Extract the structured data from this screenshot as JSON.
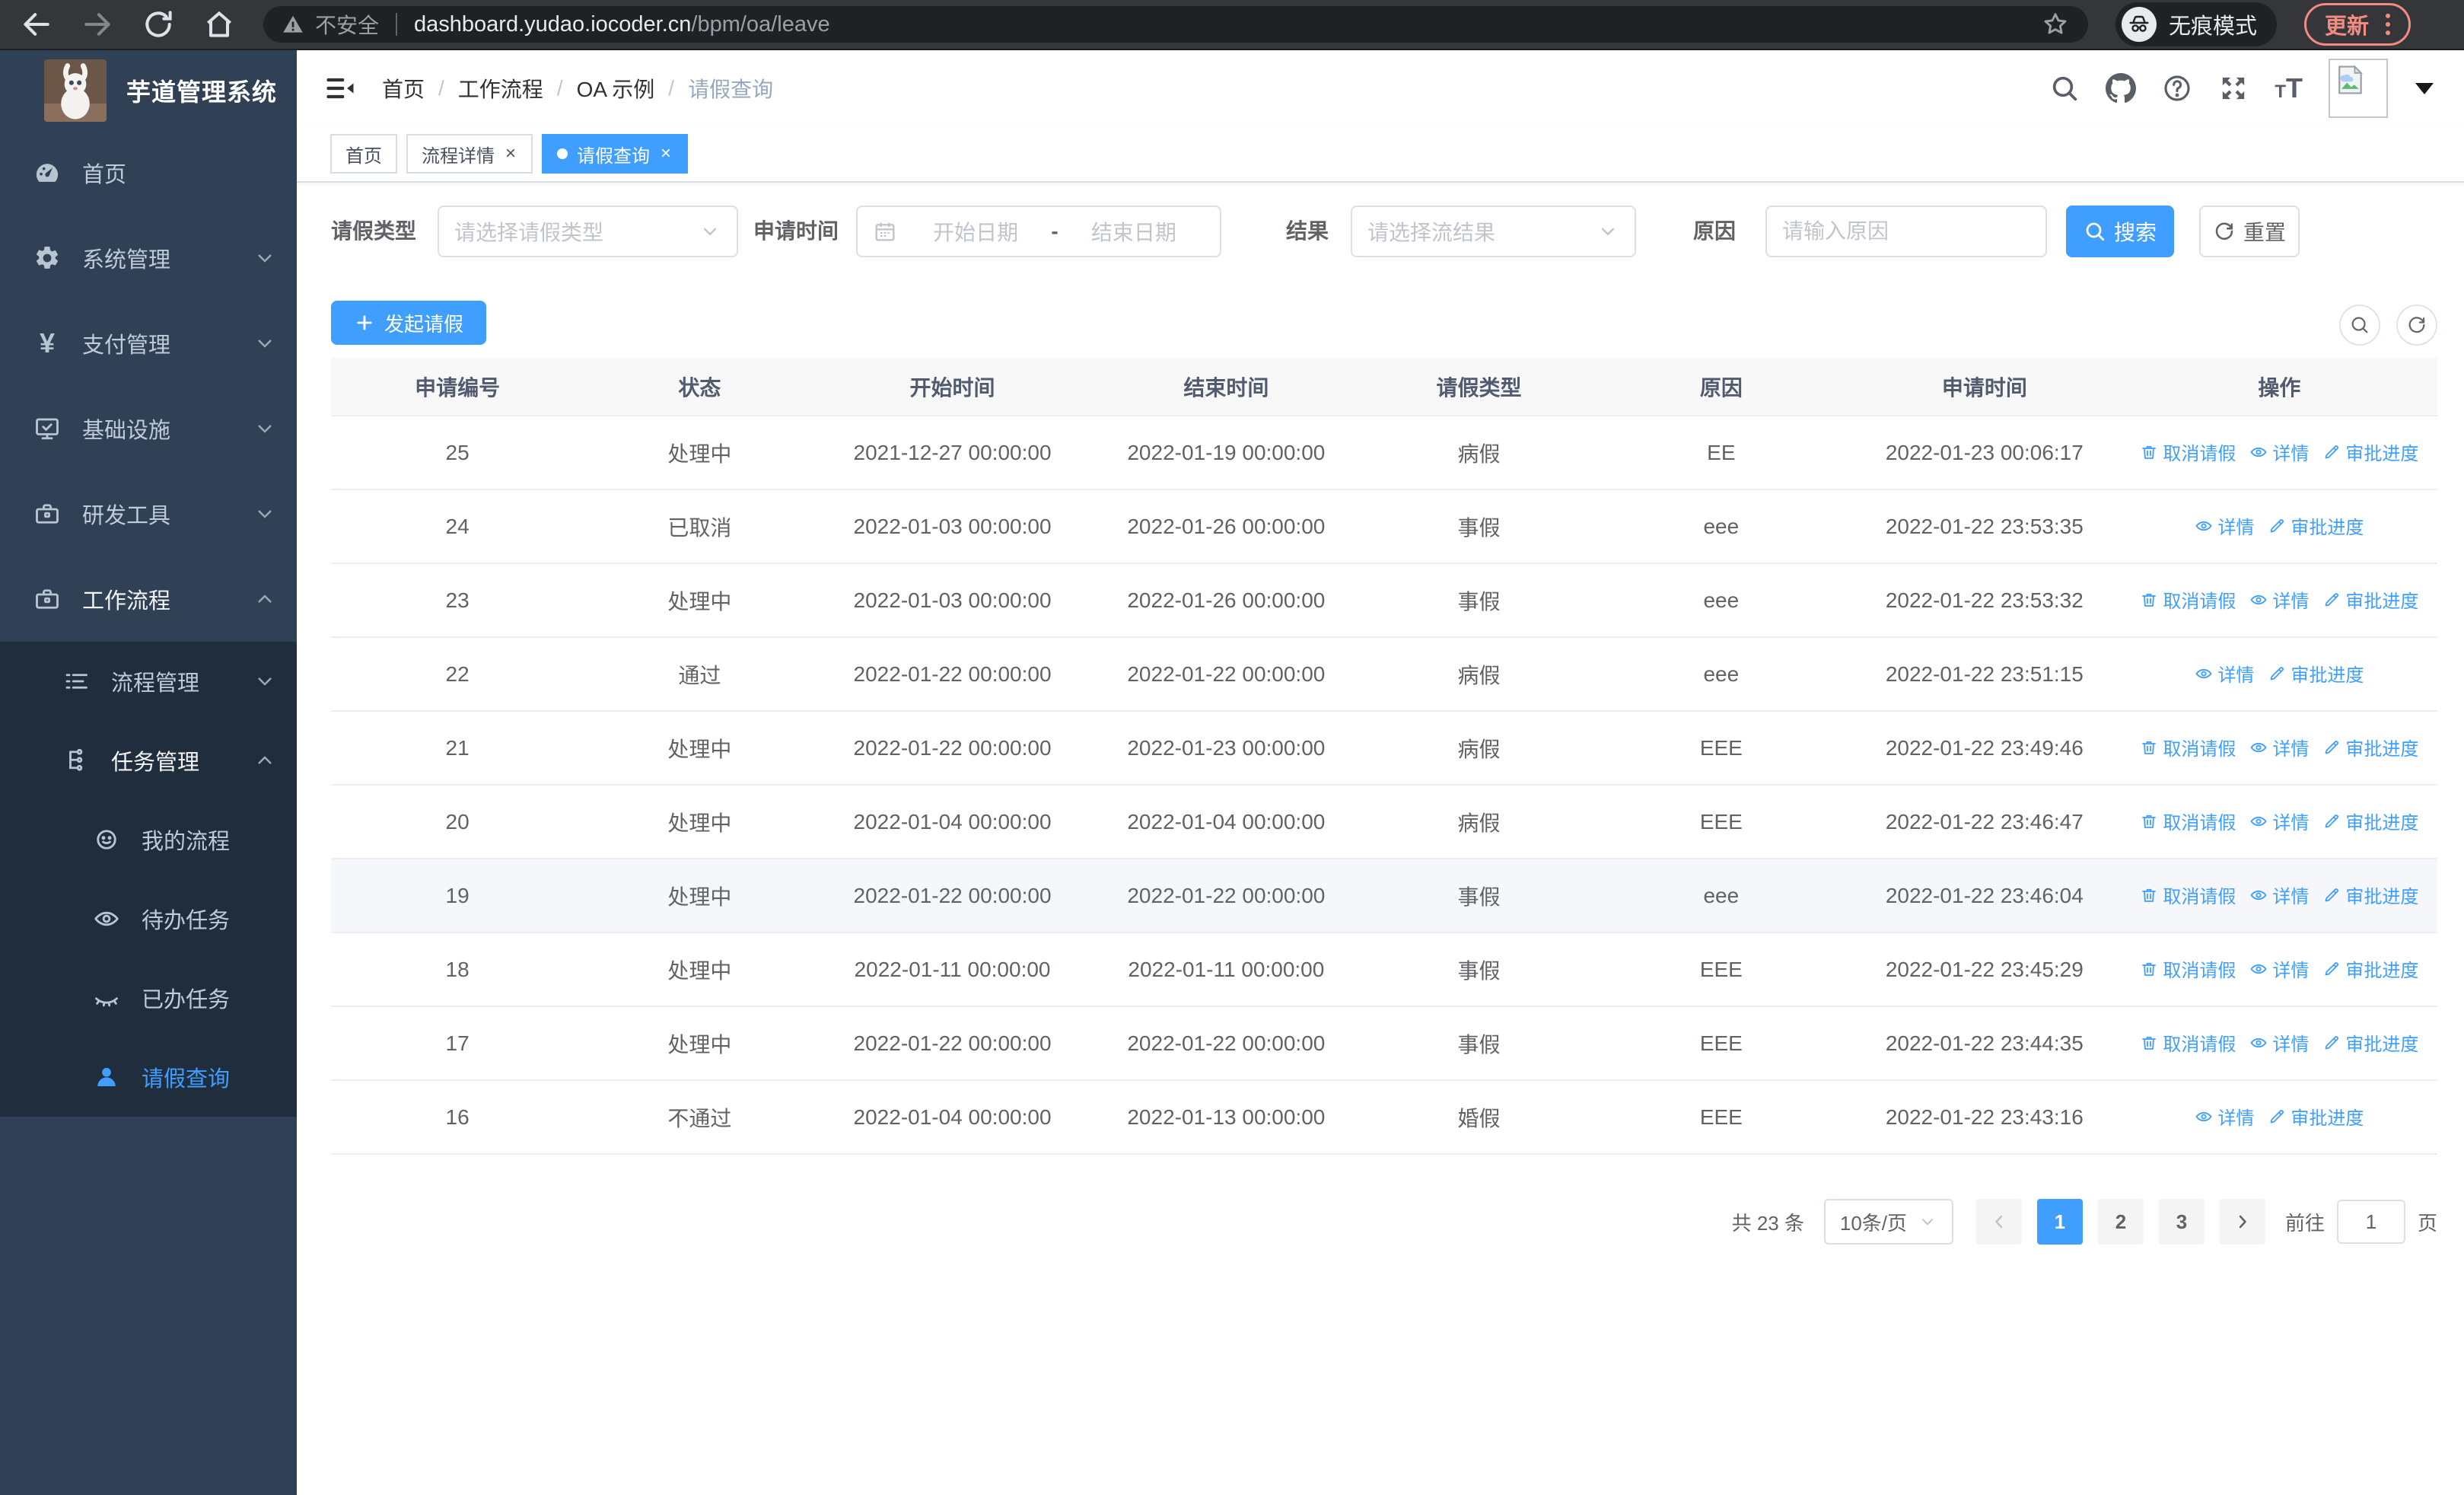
{
  "browser": {
    "security_label": "不安全",
    "url_host": "dashboard.yudao.iocoder.cn",
    "url_path": "/bpm/oa/leave",
    "incognito_label": "无痕模式",
    "update_label": "更新"
  },
  "sidebar": {
    "title": "芋道管理系统",
    "items": [
      {
        "key": "home",
        "label": "首页",
        "icon": "dashboard",
        "expandable": false,
        "expanded": false
      },
      {
        "key": "system",
        "label": "系统管理",
        "icon": "gear",
        "expandable": true,
        "expanded": false
      },
      {
        "key": "payment",
        "label": "支付管理",
        "icon": "yen",
        "expandable": true,
        "expanded": false
      },
      {
        "key": "infra",
        "label": "基础设施",
        "icon": "monitor",
        "expandable": true,
        "expanded": false
      },
      {
        "key": "devtools",
        "label": "研发工具",
        "icon": "toolbox",
        "expandable": true,
        "expanded": false
      },
      {
        "key": "workflow",
        "label": "工作流程",
        "icon": "toolbox",
        "expandable": true,
        "expanded": true
      }
    ],
    "submenu": [
      {
        "key": "process-mgmt",
        "label": "流程管理",
        "icon": "list",
        "expandable": true,
        "expanded": false
      },
      {
        "key": "task-mgmt",
        "label": "任务管理",
        "icon": "flow",
        "expandable": true,
        "expanded": true
      }
    ],
    "tasks": [
      {
        "key": "my-process",
        "label": "我的流程",
        "icon": "face",
        "active": false
      },
      {
        "key": "todo-tasks",
        "label": "待办任务",
        "icon": "eye",
        "active": false
      },
      {
        "key": "done-tasks",
        "label": "已办任务",
        "icon": "eye-closed",
        "active": false
      },
      {
        "key": "leave-query",
        "label": "请假查询",
        "icon": "user",
        "active": true
      }
    ]
  },
  "header": {
    "breadcrumb": [
      "首页",
      "工作流程",
      "OA 示例",
      "请假查询"
    ],
    "breadcrumb_separator": "/"
  },
  "tabs": [
    {
      "key": "home",
      "label": "首页",
      "closable": false,
      "active": false
    },
    {
      "key": "process-detail",
      "label": "流程详情",
      "closable": true,
      "active": false
    },
    {
      "key": "leave-query",
      "label": "请假查询",
      "closable": true,
      "active": true
    }
  ],
  "filters": {
    "leave_type": {
      "label": "请假类型",
      "placeholder": "请选择请假类型"
    },
    "apply_time": {
      "label": "申请时间",
      "start_placeholder": "开始日期",
      "separator": "-",
      "end_placeholder": "结束日期"
    },
    "result": {
      "label": "结果",
      "placeholder": "请选择流结果"
    },
    "reason": {
      "label": "原因",
      "placeholder": "请输入原因"
    },
    "search_label": "搜索",
    "reset_label": "重置"
  },
  "toolbar": {
    "create_label": "发起请假"
  },
  "table": {
    "columns": [
      {
        "key": "id",
        "label": "申请编号"
      },
      {
        "key": "status",
        "label": "状态"
      },
      {
        "key": "start",
        "label": "开始时间"
      },
      {
        "key": "end",
        "label": "结束时间"
      },
      {
        "key": "type",
        "label": "请假类型"
      },
      {
        "key": "reason",
        "label": "原因"
      },
      {
        "key": "applied",
        "label": "申请时间"
      },
      {
        "key": "actions",
        "label": "操作"
      }
    ],
    "action_labels": {
      "cancel": "取消请假",
      "detail": "详情",
      "progress": "审批进度"
    },
    "rows": [
      {
        "id": "25",
        "status": "处理中",
        "start": "2021-12-27 00:00:00",
        "end": "2022-01-19 00:00:00",
        "type": "病假",
        "reason": "EE",
        "applied": "2022-01-23 00:06:17",
        "actions": [
          "cancel",
          "detail",
          "progress"
        ],
        "highlight": false
      },
      {
        "id": "24",
        "status": "已取消",
        "start": "2022-01-03 00:00:00",
        "end": "2022-01-26 00:00:00",
        "type": "事假",
        "reason": "eee",
        "applied": "2022-01-22 23:53:35",
        "actions": [
          "detail",
          "progress"
        ],
        "highlight": false
      },
      {
        "id": "23",
        "status": "处理中",
        "start": "2022-01-03 00:00:00",
        "end": "2022-01-26 00:00:00",
        "type": "事假",
        "reason": "eee",
        "applied": "2022-01-22 23:53:32",
        "actions": [
          "cancel",
          "detail",
          "progress"
        ],
        "highlight": false
      },
      {
        "id": "22",
        "status": "通过",
        "start": "2022-01-22 00:00:00",
        "end": "2022-01-22 00:00:00",
        "type": "病假",
        "reason": "eee",
        "applied": "2022-01-22 23:51:15",
        "actions": [
          "detail",
          "progress"
        ],
        "highlight": false
      },
      {
        "id": "21",
        "status": "处理中",
        "start": "2022-01-22 00:00:00",
        "end": "2022-01-23 00:00:00",
        "type": "病假",
        "reason": "EEE",
        "applied": "2022-01-22 23:49:46",
        "actions": [
          "cancel",
          "detail",
          "progress"
        ],
        "highlight": false
      },
      {
        "id": "20",
        "status": "处理中",
        "start": "2022-01-04 00:00:00",
        "end": "2022-01-04 00:00:00",
        "type": "病假",
        "reason": "EEE",
        "applied": "2022-01-22 23:46:47",
        "actions": [
          "cancel",
          "detail",
          "progress"
        ],
        "highlight": false
      },
      {
        "id": "19",
        "status": "处理中",
        "start": "2022-01-22 00:00:00",
        "end": "2022-01-22 00:00:00",
        "type": "事假",
        "reason": "eee",
        "applied": "2022-01-22 23:46:04",
        "actions": [
          "cancel",
          "detail",
          "progress"
        ],
        "highlight": true
      },
      {
        "id": "18",
        "status": "处理中",
        "start": "2022-01-11 00:00:00",
        "end": "2022-01-11 00:00:00",
        "type": "事假",
        "reason": "EEE",
        "applied": "2022-01-22 23:45:29",
        "actions": [
          "cancel",
          "detail",
          "progress"
        ],
        "highlight": false
      },
      {
        "id": "17",
        "status": "处理中",
        "start": "2022-01-22 00:00:00",
        "end": "2022-01-22 00:00:00",
        "type": "事假",
        "reason": "EEE",
        "applied": "2022-01-22 23:44:35",
        "actions": [
          "cancel",
          "detail",
          "progress"
        ],
        "highlight": false
      },
      {
        "id": "16",
        "status": "不通过",
        "start": "2022-01-04 00:00:00",
        "end": "2022-01-13 00:00:00",
        "type": "婚假",
        "reason": "EEE",
        "applied": "2022-01-22 23:43:16",
        "actions": [
          "detail",
          "progress"
        ],
        "highlight": false
      }
    ]
  },
  "pagination": {
    "total_label": "共 23 条",
    "page_size": "10条/页",
    "pages": [
      "1",
      "2",
      "3"
    ],
    "current_page": "1",
    "goto_label": "前往",
    "goto_value": "1",
    "goto_suffix": "页"
  },
  "colors": {
    "accent": "#409eff",
    "sidebar_bg": "#304156",
    "submenu_bg": "#1f2d3d",
    "update_badge": "#f28b82",
    "table_border": "#ebeef5"
  }
}
